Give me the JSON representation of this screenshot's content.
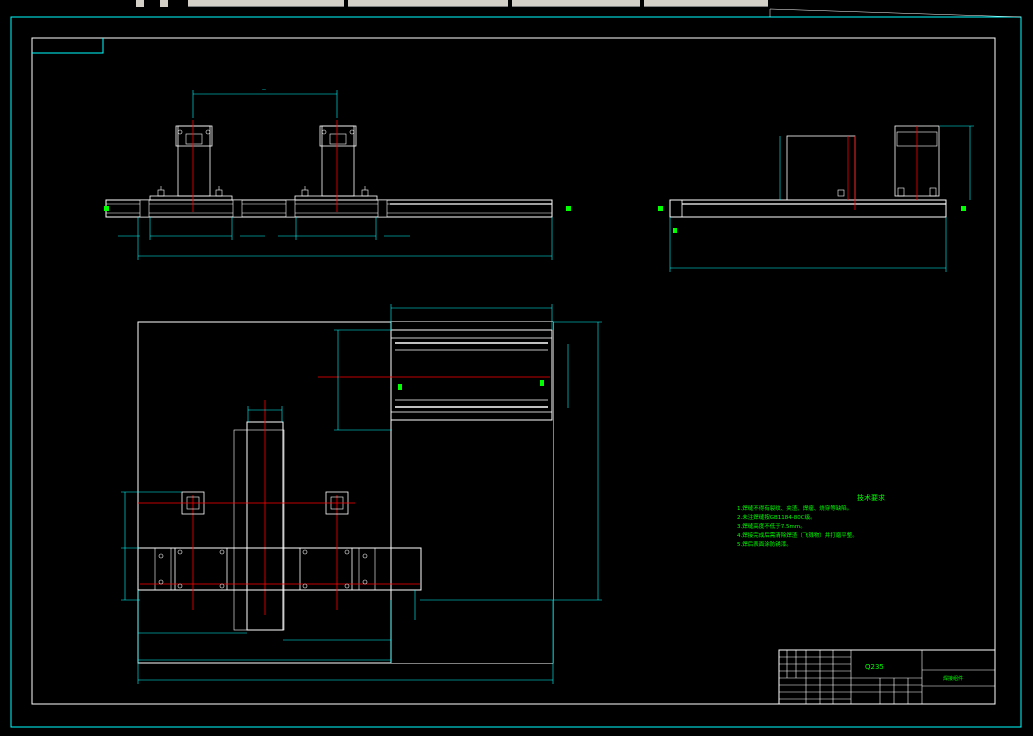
{
  "toolbar": {
    "tabs": [
      "",
      "",
      "",
      "",
      "",
      ""
    ]
  },
  "drawing": {
    "tech_requirements": {
      "title": "技术要求",
      "items": [
        "1.焊缝不得有裂纹、夹渣、焊瘤、烧穿等缺陷。",
        "2.未注焊缝按GB1184-80C级。",
        "3.焊缝高度不低于7.5mm。",
        "4.焊接完成后需清除焊渣（飞溅物）并打磨平整。",
        "5.焊后表面涂防锈漆。"
      ]
    },
    "title_block": {
      "material": "Q235",
      "drawing_name": "焊接组件"
    }
  },
  "colors": {
    "frame": "#00ffff",
    "outline": "#ffffff",
    "centerline": "#ff0000",
    "text": "#00ff00",
    "background": "#000000"
  }
}
